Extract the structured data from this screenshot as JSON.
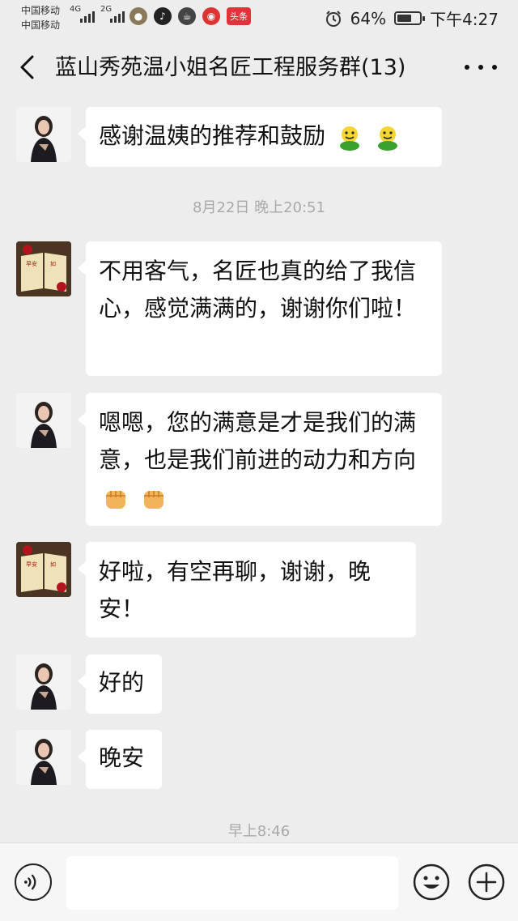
{
  "status_bar": {
    "carrier_1": "中国移动",
    "carrier_2": "中国移动",
    "network_1": "4G",
    "network_2": "2G",
    "toutiao_label": "头条",
    "battery_percent": "64%",
    "battery_level": 0.64,
    "time": "下午4:27"
  },
  "header": {
    "title": "蓝山秀苑温小姐名匠工程服务群(13)"
  },
  "messages": [
    {
      "sender": "wen",
      "text": "感谢温姨的推荐和鼓励",
      "emoji": "green-smiley"
    },
    {
      "sender": "client",
      "text": "不用客气，名匠也真的给了我信心，感觉满满的，谢谢你们啦！"
    },
    {
      "sender": "wen",
      "text": "嗯嗯，您的满意是才是我们的满意，也是我们前进的动力和方向",
      "emoji": "fist"
    },
    {
      "sender": "client",
      "text": "好啦，有空再聊，谢谢，晚安！"
    },
    {
      "sender": "wen",
      "text": "好的"
    },
    {
      "sender": "wen",
      "text": "晚安"
    }
  ],
  "timestamps": {
    "t1": "8月22日 晚上20:51",
    "t2": "早上8:46"
  },
  "colors": {
    "background": "#ededed",
    "bubble": "#ffffff",
    "timestamp_text": "#a9a9a9",
    "toutiao_red": "#e2333a"
  },
  "icons": {
    "back": "chevron-left-icon",
    "more": "more-dots-icon",
    "voice": "voice-icon",
    "emoji": "emoji-smiley-icon",
    "plus": "plus-icon"
  }
}
